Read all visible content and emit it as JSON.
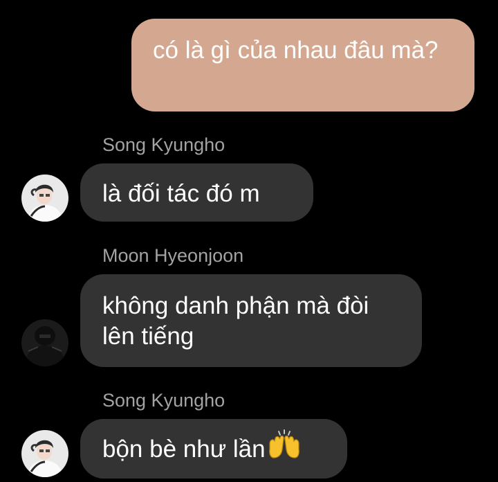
{
  "messages": [
    {
      "sender": "",
      "direction": "outgoing",
      "text": "có là gì của nhau đâu mà?"
    },
    {
      "sender": "Song Kyungho",
      "direction": "incoming",
      "text": "là đối tác đó m",
      "avatar_icon": "user-avatar-icon"
    },
    {
      "sender": "Moon Hyeonjoon",
      "direction": "incoming",
      "text": "không danh phận mà đòi lên tiếng",
      "avatar_icon": "user-avatar-icon"
    },
    {
      "sender": "Song Kyungho",
      "direction": "incoming",
      "text": "bộn bè như lần",
      "emoji_icon": "raising-hands-emoji-icon",
      "avatar_icon": "user-avatar-icon"
    }
  ],
  "colors": {
    "background": "#000000",
    "outgoing_bubble": "#d4a890",
    "incoming_bubble": "#333333",
    "sender_name": "#a3a3a3",
    "message_text": "#ffffff"
  }
}
